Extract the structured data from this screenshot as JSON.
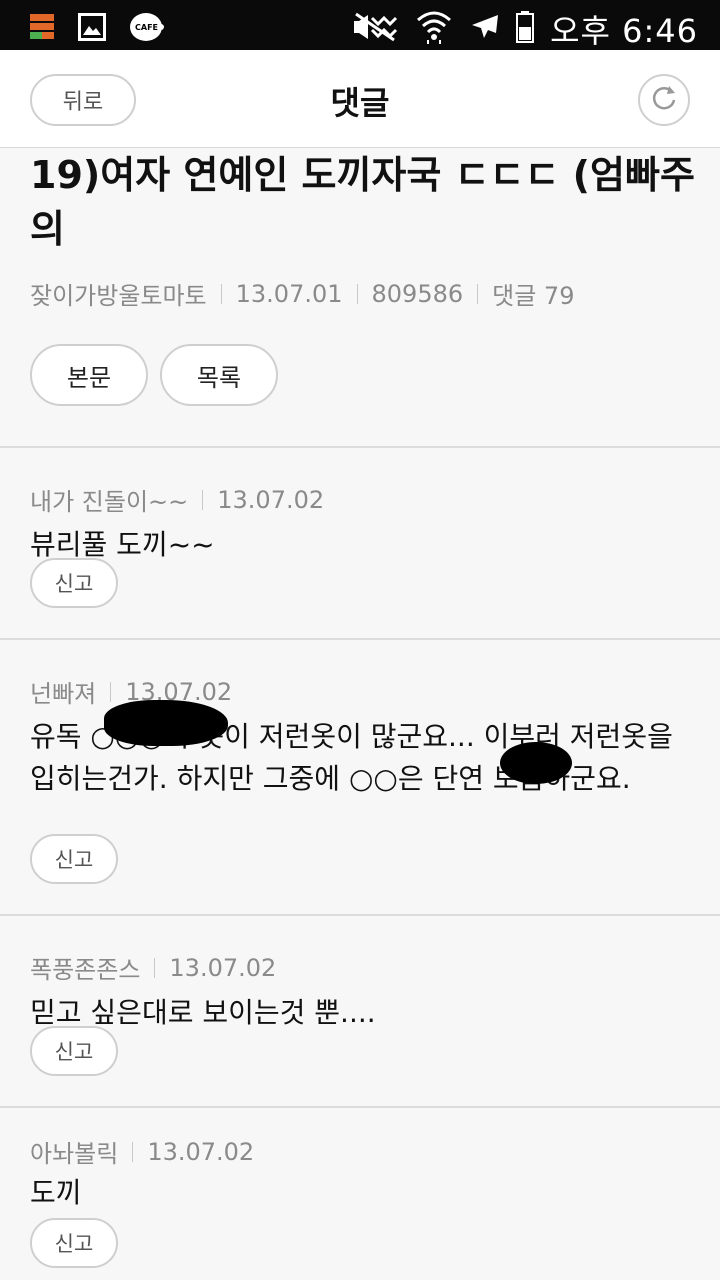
{
  "status_bar": {
    "time": "오후 6:46",
    "left_icons": [
      "notification-icon",
      "gallery-icon",
      "cafe-icon"
    ],
    "right_icons": [
      "mute-icon",
      "wifi-icon",
      "airplane-icon",
      "battery-icon"
    ],
    "cafe_label": "CAFE"
  },
  "header": {
    "back_label": "뒤로",
    "title": "댓글"
  },
  "post": {
    "title": "19)여자 연예인 도끼자국 ㄷㄷㄷ (엄빠주의",
    "author": "잦이가방울토마토",
    "date": "13.07.01",
    "views": "809586",
    "comments": "댓글 79",
    "body_button": "본문",
    "list_button": "목록"
  },
  "comments": [
    {
      "author": "내가 진돌이~~",
      "date": "13.07.02",
      "text": "뷰리풀 도끼~~",
      "report_label": "신고"
    },
    {
      "author": "넌빠져",
      "date": "13.07.02",
      "text": "유독 ○○○의 옷이 저런옷이 많군요... 이부러 저런옷을 입히는건가. 하지만 그중에 ○○은 단연 보톰하군요.",
      "report_label": "신고"
    },
    {
      "author": "폭풍존존스",
      "date": "13.07.02",
      "text": "믿고 싶은대로 보이는것 뿐....",
      "report_label": "신고"
    },
    {
      "author": "아놔볼릭",
      "date": "13.07.02",
      "text": "도끼",
      "report_label": "신고"
    }
  ]
}
